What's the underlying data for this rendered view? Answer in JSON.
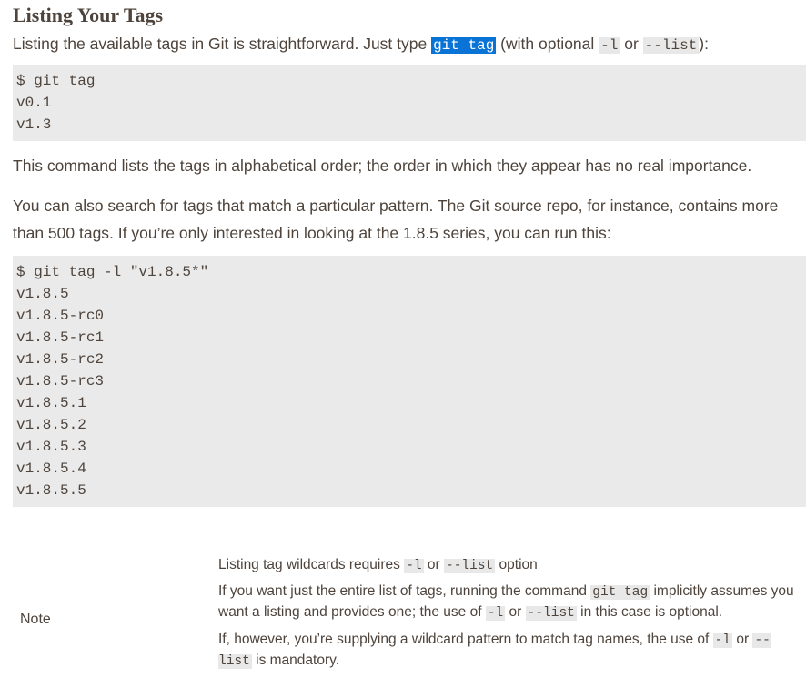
{
  "heading": "Listing Your Tags",
  "intro": {
    "text1": "Listing the available tags in Git is straightforward. Just type ",
    "code1": "git tag",
    "text2": " (with optional ",
    "code2": "-l",
    "text3": " or ",
    "code3": "--list",
    "text4": "):"
  },
  "code_block_1": [
    "$ git tag",
    "v0.1",
    "v1.3"
  ],
  "para_order": "This command lists the tags in alphabetical order; the order in which they appear has no real importance.",
  "para_search": "You can also search for tags that match a particular pattern. The Git source repo, for instance, contains more than 500 tags. If you’re only interested in looking at the 1.8.5 series, you can run this:",
  "code_block_2": [
    "$ git tag -l \"v1.8.5*\"",
    "v1.8.5",
    "v1.8.5-rc0",
    "v1.8.5-rc1",
    "v1.8.5-rc2",
    "v1.8.5-rc3",
    "v1.8.5.1",
    "v1.8.5.2",
    "v1.8.5.3",
    "v1.8.5.4",
    "v1.8.5.5"
  ],
  "note": {
    "label": "Note",
    "title_text1": "Listing tag wildcards requires ",
    "title_code1": "-l",
    "title_text2": " or ",
    "title_code2": "--list",
    "title_text3": " option",
    "p1_text1": "If you want just the entire list of tags, running the command ",
    "p1_code1": "git tag",
    "p1_text2": " implicitly assumes you want a listing and provides one; the use of ",
    "p1_code2": "-l",
    "p1_text3": " or ",
    "p1_code3": "--list",
    "p1_text4": " in this case is optional.",
    "p2_text1": "If, however, you’re supplying a wildcard pattern to match tag names, the use of ",
    "p2_code1": "-l",
    "p2_text2": " or ",
    "p2_code2": "--list",
    "p2_text3": " is mandatory."
  }
}
